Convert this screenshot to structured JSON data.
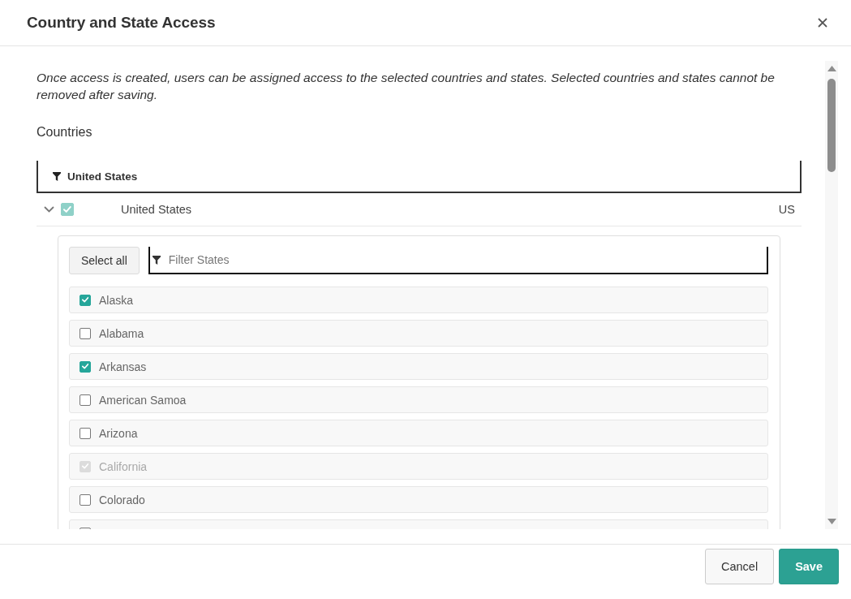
{
  "dialog": {
    "title": "Country and State Access"
  },
  "description": "Once access is created, users can be assigned access to the selected countries and states. Selected countries and states cannot be removed after saving.",
  "countries_label": "Countries",
  "country_filter": {
    "value": "United States"
  },
  "countries": [
    {
      "name": "United States",
      "code": "US",
      "expanded": true,
      "checked": true,
      "disabled": true,
      "select_all": "Select all",
      "state_filter": {
        "placeholder": "Filter States"
      },
      "states": [
        {
          "name": "Alaska",
          "checked": true,
          "disabled": false
        },
        {
          "name": "Alabama",
          "checked": false,
          "disabled": false
        },
        {
          "name": "Arkansas",
          "checked": true,
          "disabled": false
        },
        {
          "name": "American Samoa",
          "checked": false,
          "disabled": false
        },
        {
          "name": "Arizona",
          "checked": false,
          "disabled": false
        },
        {
          "name": "California",
          "checked": true,
          "disabled": true
        },
        {
          "name": "Colorado",
          "checked": false,
          "disabled": false
        },
        {
          "checked": false,
          "disabled": false
        }
      ]
    }
  ],
  "buttons": [
    {
      "label": "Cancel",
      "kind": "secondary"
    },
    {
      "label": "Save",
      "kind": "primary"
    }
  ]
}
